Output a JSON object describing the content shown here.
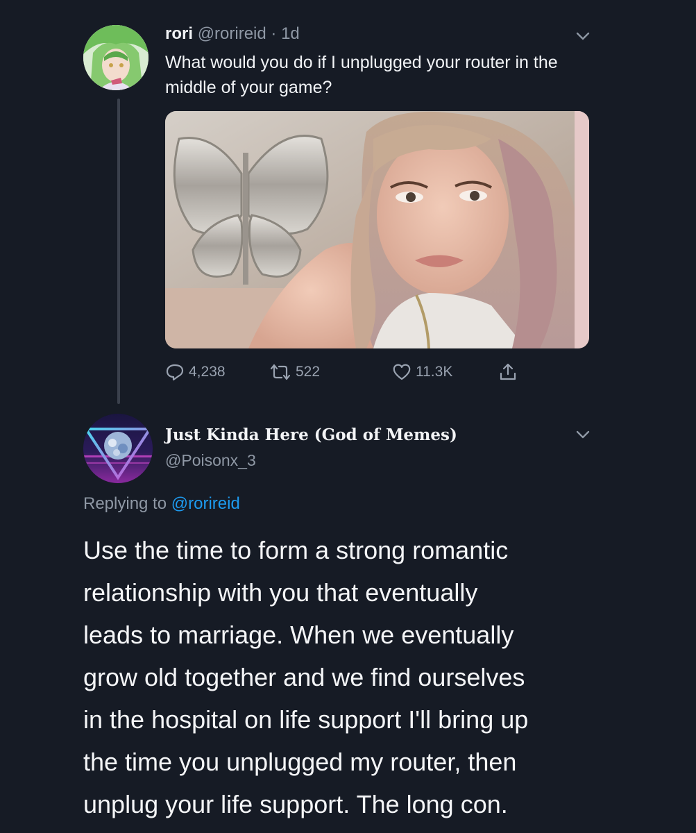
{
  "tweet1": {
    "display_name": "rori",
    "handle": "@rorireid",
    "separator": "·",
    "time": "1d",
    "text": "What would you do if I unplugged your router in the middle of your game?",
    "stats": {
      "replies": "4,238",
      "retweets": "522",
      "likes": "11.3K"
    },
    "icons": [
      "reply-icon",
      "retweet-icon",
      "like-icon",
      "share-icon",
      "chevron-down-icon"
    ]
  },
  "tweet2": {
    "display_name": "Just Kinda Here (God of Memes)",
    "handle": "@Poisonx_3",
    "replying_prefix": "Replying to",
    "replying_mention": "@rorireid",
    "text_lines": [
      "Use the time to form a strong romantic",
      "relationship with you that eventually",
      "leads to marriage. When we eventually",
      "grow old together and we find ourselves",
      "in the hospital on life support I'll bring up",
      "the time you unplugged my router, then",
      "unplug your life support. The long con."
    ]
  },
  "colors": {
    "background": "#161b25",
    "secondary_text": "#8f98a5",
    "mention": "#1d9bf0"
  }
}
